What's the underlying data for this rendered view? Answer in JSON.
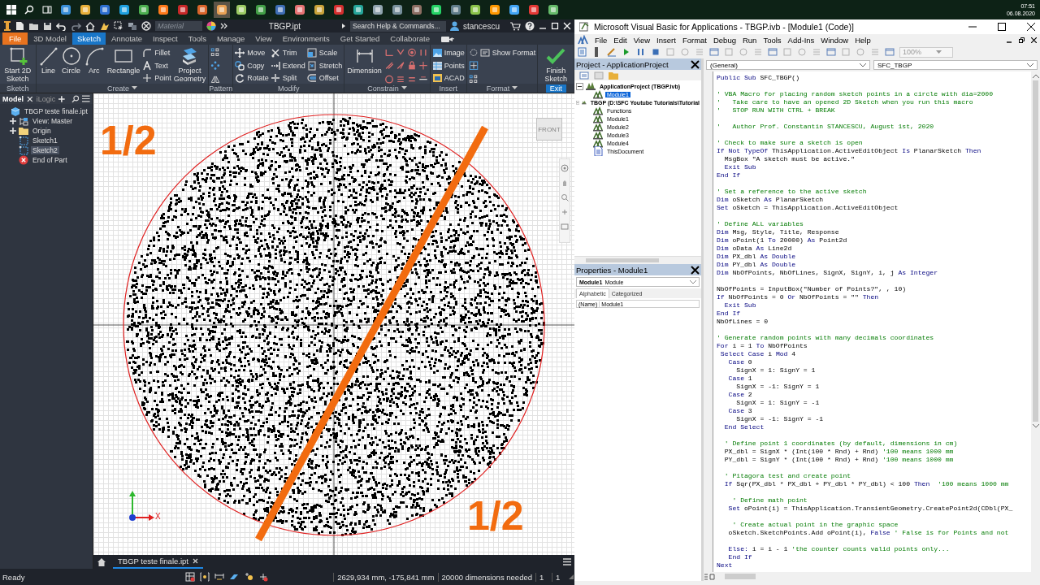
{
  "taskbar": {
    "time": "07:51",
    "date": "06.08.2020"
  },
  "inventor": {
    "title_bar": {
      "material_placeholder": "Material",
      "document": "TBGP.ipt",
      "search_placeholder": "Search Help & Commands...",
      "user": "stancescu"
    },
    "ribbon_tabs": [
      {
        "label": "File",
        "kind": "file",
        "selected": false
      },
      {
        "label": "3D Model",
        "kind": "tab",
        "selected": false
      },
      {
        "label": "Sketch",
        "kind": "tab",
        "selected": true
      },
      {
        "label": "Annotate",
        "kind": "tab",
        "selected": false
      },
      {
        "label": "Inspect",
        "kind": "tab",
        "selected": false
      },
      {
        "label": "Tools",
        "kind": "tab",
        "selected": false
      },
      {
        "label": "Manage",
        "kind": "tab",
        "selected": false
      },
      {
        "label": "View",
        "kind": "tab",
        "selected": false
      },
      {
        "label": "Environments",
        "kind": "tab",
        "selected": false
      },
      {
        "label": "Get Started",
        "kind": "tab",
        "selected": false
      },
      {
        "label": "Collaborate",
        "kind": "tab",
        "selected": false
      }
    ],
    "ribbon_groups": [
      {
        "title": "Sketch",
        "kind": "panel",
        "columns": [
          {
            "kind": "large",
            "label": "Start 2D Sketch"
          }
        ]
      },
      {
        "title": "Create",
        "kind": "dropdown",
        "columns": [
          {
            "kind": "large",
            "label": "Line"
          },
          {
            "kind": "large",
            "label": "Circle"
          },
          {
            "kind": "large",
            "label": "Arc"
          },
          {
            "kind": "large",
            "label": "Rectangle"
          },
          {
            "kind": "stack",
            "items": [
              "Fillet",
              "Text",
              "Point"
            ]
          },
          {
            "kind": "large",
            "label": "Project Geometry"
          }
        ]
      },
      {
        "title": "Pattern",
        "kind": "panel",
        "columns": [
          {
            "kind": "icons"
          }
        ]
      },
      {
        "title": "Modify",
        "kind": "panel",
        "columns": [
          {
            "kind": "stack",
            "items": [
              "Move",
              "Copy",
              "Rotate"
            ]
          },
          {
            "kind": "stack",
            "items": [
              "Trim",
              "Extend",
              "Split"
            ]
          },
          {
            "kind": "stack",
            "items": [
              "Scale",
              "Stretch",
              "Offset"
            ]
          }
        ]
      },
      {
        "title": "Constrain",
        "kind": "dropdown",
        "columns": [
          {
            "kind": "large",
            "label": "Dimension"
          },
          {
            "kind": "icons"
          },
          {
            "kind": "icons"
          },
          {
            "kind": "icons"
          },
          {
            "kind": "icons"
          }
        ]
      },
      {
        "title": "Insert",
        "kind": "panel",
        "columns": [
          {
            "kind": "stack",
            "items": [
              "Image",
              "Points",
              "ACAD"
            ]
          }
        ]
      },
      {
        "title": "Format",
        "kind": "dropdown",
        "columns": [
          {
            "kind": "icons"
          },
          {
            "kind": "stack",
            "items": [
              "Show Format"
            ]
          }
        ]
      },
      {
        "title": "Exit",
        "kind": "exit",
        "columns": [
          {
            "kind": "large",
            "label": "Finish Sketch"
          }
        ]
      }
    ],
    "browser": {
      "tabs": [
        {
          "label": "Model",
          "selected": true
        },
        {
          "label": "iLogic",
          "selected": false
        }
      ],
      "tree": [
        {
          "label": "TBGP teste finale.ipt",
          "kind": "part",
          "selected": false,
          "children": [
            {
              "label": "View: Master",
              "kind": "view",
              "selected": false,
              "expanded": false
            },
            {
              "label": "Origin",
              "kind": "folder",
              "selected": false,
              "expanded": false
            },
            {
              "label": "Sketch1",
              "kind": "sketch",
              "selected": false
            },
            {
              "label": "Sketch2",
              "kind": "sketch",
              "selected": true
            },
            {
              "label": "End of Part",
              "kind": "end",
              "selected": false
            }
          ]
        }
      ]
    },
    "canvas": {
      "labels": [
        "1/2",
        "1/2"
      ],
      "view_cube": "FRONT",
      "axis_label": "X"
    },
    "document_tabs": [
      {
        "label": "TBGP teste finale.ipt",
        "selected": true
      }
    ],
    "status_bar": {
      "message": "Ready",
      "coordinates": "2629,934 mm, -175,841 mm",
      "constraints": "20000 dimensions needed",
      "fields": [
        "1",
        "1"
      ]
    }
  },
  "vba": {
    "title": "Microsoft Visual Basic for Applications - TBGP.ivb - [Module1 (Code)]",
    "menu": [
      "File",
      "Edit",
      "View",
      "Insert",
      "Format",
      "Debug",
      "Run",
      "Tools",
      "Add-Ins",
      "Window",
      "Help"
    ],
    "zoom": "100%",
    "project": {
      "title": "Project - ApplicationProject",
      "tree": [
        {
          "label": "ApplicationProject (TBGP.ivb)",
          "kind": "project",
          "selected": false,
          "expanded": true,
          "children": [
            {
              "label": "Module1",
              "kind": "module",
              "selected": true
            }
          ]
        },
        {
          "label": "TBGP (D:\\SFC Youtube Tutorials\\Tutorial",
          "kind": "project",
          "selected": false,
          "expanded": true,
          "children": [
            {
              "label": "Functions",
              "kind": "module",
              "selected": false
            },
            {
              "label": "Module1",
              "kind": "module",
              "selected": false
            },
            {
              "label": "Module2",
              "kind": "module",
              "selected": false
            },
            {
              "label": "Module3",
              "kind": "module",
              "selected": false
            },
            {
              "label": "Module4",
              "kind": "module",
              "selected": false
            },
            {
              "label": "ThisDocument",
              "kind": "document",
              "selected": false
            }
          ]
        }
      ]
    },
    "properties": {
      "title": "Properties - Module1",
      "object": "Module1",
      "object_type": "Module",
      "tabs": [
        {
          "label": "Alphabetic",
          "selected": true
        },
        {
          "label": "Categorized",
          "selected": false
        }
      ],
      "rows": [
        {
          "name": "(Name)",
          "value": "Module1"
        }
      ]
    },
    "code": {
      "object": "(General)",
      "procedure": "SFC_TBGP",
      "lines": [
        {
          "kind": "code",
          "parts": [
            {
              "kind": "keyword",
              "text": "Public Sub"
            },
            {
              "kind": "code",
              "text": " SFC_TBGP()"
            }
          ]
        },
        {
          "kind": "blank"
        },
        {
          "kind": "code",
          "parts": [
            {
              "kind": "comment",
              "text": "' VBA Macro for placing random sketch points in a circle with dia=2000"
            }
          ]
        },
        {
          "kind": "code",
          "parts": [
            {
              "kind": "comment",
              "text": "'   Take care to have an opened 2D Sketch when you run this macro"
            }
          ]
        },
        {
          "kind": "code",
          "parts": [
            {
              "kind": "comment",
              "text": "'   STOP RUN WITH CTRL + BREAK"
            }
          ]
        },
        {
          "kind": "blank"
        },
        {
          "kind": "code",
          "parts": [
            {
              "kind": "comment",
              "text": "'   Author Prof. Constantin STANCESCU, August 1st, 2020"
            }
          ]
        },
        {
          "kind": "blank"
        },
        {
          "kind": "code",
          "parts": [
            {
              "kind": "comment",
              "text": "' Check to make sure a sketch is open"
            }
          ]
        },
        {
          "kind": "code",
          "parts": [
            {
              "kind": "keyword",
              "text": "If Not TypeOf"
            },
            {
              "kind": "code",
              "text": " ThisApplication.ActiveEditObject "
            },
            {
              "kind": "keyword",
              "text": "Is"
            },
            {
              "kind": "code",
              "text": " PlanarSketch "
            },
            {
              "kind": "keyword",
              "text": "Then"
            }
          ]
        },
        {
          "kind": "code",
          "parts": [
            {
              "kind": "code",
              "text": "  MsgBox \"A sketch must be active.\""
            }
          ]
        },
        {
          "kind": "code",
          "parts": [
            {
              "kind": "keyword",
              "text": "  Exit Sub"
            }
          ]
        },
        {
          "kind": "code",
          "parts": [
            {
              "kind": "keyword",
              "text": "End If"
            }
          ]
        },
        {
          "kind": "blank"
        },
        {
          "kind": "code",
          "parts": [
            {
              "kind": "comment",
              "text": "' Set a reference to the active sketch"
            }
          ]
        },
        {
          "kind": "code",
          "parts": [
            {
              "kind": "keyword",
              "text": "Dim"
            },
            {
              "kind": "code",
              "text": " oSketch "
            },
            {
              "kind": "keyword",
              "text": "As"
            },
            {
              "kind": "code",
              "text": " PlanarSketch"
            }
          ]
        },
        {
          "kind": "code",
          "parts": [
            {
              "kind": "keyword",
              "text": "Set"
            },
            {
              "kind": "code",
              "text": " oSketch = ThisApplication.ActiveEditObject"
            }
          ]
        },
        {
          "kind": "blank"
        },
        {
          "kind": "code",
          "parts": [
            {
              "kind": "comment",
              "text": "' Define ALL variables"
            }
          ]
        },
        {
          "kind": "code",
          "parts": [
            {
              "kind": "keyword",
              "text": "Dim"
            },
            {
              "kind": "code",
              "text": " Msg, Style, Title, Response"
            }
          ]
        },
        {
          "kind": "code",
          "parts": [
            {
              "kind": "keyword",
              "text": "Dim"
            },
            {
              "kind": "code",
              "text": " oPoint(1 "
            },
            {
              "kind": "keyword",
              "text": "To"
            },
            {
              "kind": "code",
              "text": " 20000) "
            },
            {
              "kind": "keyword",
              "text": "As"
            },
            {
              "kind": "code",
              "text": " Point2d"
            }
          ]
        },
        {
          "kind": "code",
          "parts": [
            {
              "kind": "keyword",
              "text": "Dim"
            },
            {
              "kind": "code",
              "text": " oData "
            },
            {
              "kind": "keyword",
              "text": "As"
            },
            {
              "kind": "code",
              "text": " Line2d"
            }
          ]
        },
        {
          "kind": "code",
          "parts": [
            {
              "kind": "keyword",
              "text": "Dim"
            },
            {
              "kind": "code",
              "text": " PX_dbl "
            },
            {
              "kind": "keyword",
              "text": "As Double"
            }
          ]
        },
        {
          "kind": "code",
          "parts": [
            {
              "kind": "keyword",
              "text": "Dim"
            },
            {
              "kind": "code",
              "text": " PY_dbl "
            },
            {
              "kind": "keyword",
              "text": "As Double"
            }
          ]
        },
        {
          "kind": "code",
          "parts": [
            {
              "kind": "keyword",
              "text": "Dim"
            },
            {
              "kind": "code",
              "text": " NbOfPoints, NbOfLines, SignX, SignY, i, j "
            },
            {
              "kind": "keyword",
              "text": "As Integer"
            }
          ]
        },
        {
          "kind": "blank"
        },
        {
          "kind": "code",
          "parts": [
            {
              "kind": "code",
              "text": "NbOfPoints = InputBox(\"Number of Points?\", , 10)"
            }
          ]
        },
        {
          "kind": "code",
          "parts": [
            {
              "kind": "keyword",
              "text": "If"
            },
            {
              "kind": "code",
              "text": " NbOfPoints = 0 "
            },
            {
              "kind": "keyword",
              "text": "Or"
            },
            {
              "kind": "code",
              "text": " NbOfPoints = \"\" "
            },
            {
              "kind": "keyword",
              "text": "Then"
            }
          ]
        },
        {
          "kind": "code",
          "parts": [
            {
              "kind": "keyword",
              "text": "  Exit Sub"
            }
          ]
        },
        {
          "kind": "code",
          "parts": [
            {
              "kind": "keyword",
              "text": "End If"
            }
          ]
        },
        {
          "kind": "code",
          "parts": [
            {
              "kind": "code",
              "text": "NbOfLines = 0"
            }
          ]
        },
        {
          "kind": "blank"
        },
        {
          "kind": "code",
          "parts": [
            {
              "kind": "comment",
              "text": "' Generate random points with many decimals coordinates"
            }
          ]
        },
        {
          "kind": "code",
          "parts": [
            {
              "kind": "keyword",
              "text": "For"
            },
            {
              "kind": "code",
              "text": " i = 1 "
            },
            {
              "kind": "keyword",
              "text": "To"
            },
            {
              "kind": "code",
              "text": " NbOfPoints"
            }
          ]
        },
        {
          "kind": "code",
          "parts": [
            {
              "kind": "keyword",
              "text": " Select Case"
            },
            {
              "kind": "code",
              "text": " i "
            },
            {
              "kind": "keyword",
              "text": "Mod"
            },
            {
              "kind": "code",
              "text": " 4"
            }
          ]
        },
        {
          "kind": "code",
          "parts": [
            {
              "kind": "keyword",
              "text": "   Case"
            },
            {
              "kind": "code",
              "text": " 0"
            }
          ]
        },
        {
          "kind": "code",
          "parts": [
            {
              "kind": "code",
              "text": "     SignX = 1: SignY = 1"
            }
          ]
        },
        {
          "kind": "code",
          "parts": [
            {
              "kind": "keyword",
              "text": "   Case"
            },
            {
              "kind": "code",
              "text": " 1"
            }
          ]
        },
        {
          "kind": "code",
          "parts": [
            {
              "kind": "code",
              "text": "     SignX = -1: SignY = 1"
            }
          ]
        },
        {
          "kind": "code",
          "parts": [
            {
              "kind": "keyword",
              "text": "   Case"
            },
            {
              "kind": "code",
              "text": " 2"
            }
          ]
        },
        {
          "kind": "code",
          "parts": [
            {
              "kind": "code",
              "text": "     SignX = 1: SignY = -1"
            }
          ]
        },
        {
          "kind": "code",
          "parts": [
            {
              "kind": "keyword",
              "text": "   Case"
            },
            {
              "kind": "code",
              "text": " 3"
            }
          ]
        },
        {
          "kind": "code",
          "parts": [
            {
              "kind": "code",
              "text": "     SignX = -1: SignY = -1"
            }
          ]
        },
        {
          "kind": "code",
          "parts": [
            {
              "kind": "keyword",
              "text": "  End Select"
            }
          ]
        },
        {
          "kind": "blank"
        },
        {
          "kind": "code",
          "parts": [
            {
              "kind": "comment",
              "text": "  ' Define point 1 coordinates (by default, dimensions in cm)"
            }
          ]
        },
        {
          "kind": "code",
          "parts": [
            {
              "kind": "code",
              "text": "  PX_dbl = SignX * (Int(100 * Rnd) + Rnd) "
            },
            {
              "kind": "comment",
              "text": "'100 means 1000 mm"
            }
          ]
        },
        {
          "kind": "code",
          "parts": [
            {
              "kind": "code",
              "text": "  PY_dbl = SignY * (Int(100 * Rnd) + Rnd) "
            },
            {
              "kind": "comment",
              "text": "'100 means 1000 mm"
            }
          ]
        },
        {
          "kind": "blank"
        },
        {
          "kind": "code",
          "parts": [
            {
              "kind": "comment",
              "text": "  ' Pitagora test and create point"
            }
          ]
        },
        {
          "kind": "code",
          "parts": [
            {
              "kind": "keyword",
              "text": "  If"
            },
            {
              "kind": "code",
              "text": " Sqr(PX_dbl * PX_dbl + PY_dbl * PY_dbl) < 100 "
            },
            {
              "kind": "keyword",
              "text": "Then"
            },
            {
              "kind": "comment",
              "text": "  '100 means 1000 mm"
            }
          ]
        },
        {
          "kind": "blank"
        },
        {
          "kind": "code",
          "parts": [
            {
              "kind": "comment",
              "text": "    ' Define math point"
            }
          ]
        },
        {
          "kind": "code",
          "parts": [
            {
              "kind": "keyword",
              "text": "   Set"
            },
            {
              "kind": "code",
              "text": " oPoint(i) = ThisApplication.TransientGeometry.CreatePoint2d(CDbl(PX_"
            }
          ]
        },
        {
          "kind": "blank"
        },
        {
          "kind": "code",
          "parts": [
            {
              "kind": "comment",
              "text": "    ' Create actual point in the graphic space"
            }
          ]
        },
        {
          "kind": "code",
          "parts": [
            {
              "kind": "code",
              "text": "   oSketch.SketchPoints.Add oPoint(i), "
            },
            {
              "kind": "keyword",
              "text": "False"
            },
            {
              "kind": "comment",
              "text": " ' False is for Points and not"
            }
          ]
        },
        {
          "kind": "blank"
        },
        {
          "kind": "code",
          "parts": [
            {
              "kind": "keyword",
              "text": "   Else:"
            },
            {
              "kind": "code",
              "text": " i = i - 1 "
            },
            {
              "kind": "comment",
              "text": "'the counter counts valid points only..."
            }
          ]
        },
        {
          "kind": "code",
          "parts": [
            {
              "kind": "keyword",
              "text": "   End If"
            }
          ]
        },
        {
          "kind": "code",
          "parts": [
            {
              "kind": "keyword",
              "text": "Next"
            }
          ]
        }
      ]
    }
  }
}
